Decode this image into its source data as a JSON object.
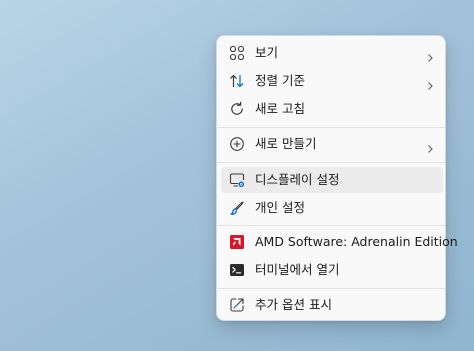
{
  "context_menu": {
    "items": [
      {
        "label": "보기",
        "icon": "grid-view-icon",
        "has_submenu": true
      },
      {
        "label": "정렬 기준",
        "icon": "sort-arrows-icon",
        "has_submenu": true
      },
      {
        "label": "새로 고침",
        "icon": "refresh-icon",
        "has_submenu": false
      },
      {
        "label": "새로 만들기",
        "icon": "plus-circle-icon",
        "has_submenu": true
      },
      {
        "label": "디스플레이 설정",
        "icon": "display-settings-icon",
        "has_submenu": false,
        "highlighted": true
      },
      {
        "label": "개인 설정",
        "icon": "paintbrush-icon",
        "has_submenu": false
      },
      {
        "label": "AMD Software: Adrenalin Edition",
        "icon": "amd-logo-icon",
        "has_submenu": false
      },
      {
        "label": "터미널에서 열기",
        "icon": "terminal-icon",
        "has_submenu": false
      },
      {
        "label": "추가 옵션 표시",
        "icon": "show-more-options-icon",
        "has_submenu": false
      }
    ]
  },
  "colors": {
    "accent": "#0067c0",
    "amd_red": "#d9172a",
    "menu_background": "#f9f9f9",
    "highlight": "#ececec"
  }
}
